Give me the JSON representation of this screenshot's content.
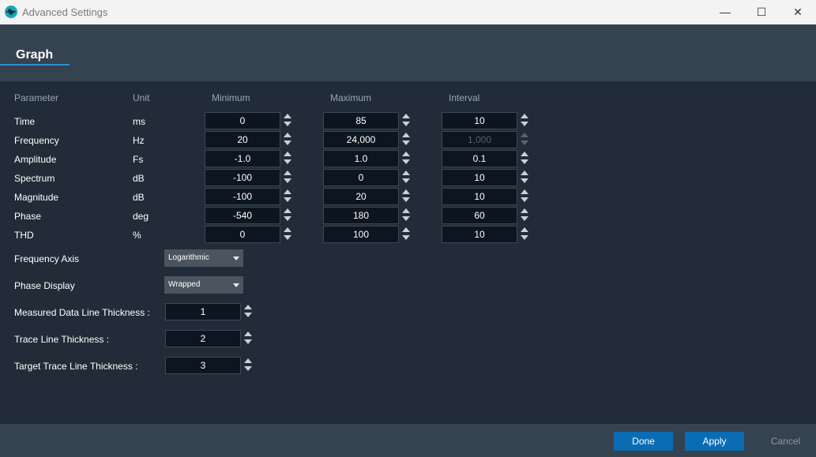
{
  "window": {
    "title": "Advanced Settings",
    "minimize_glyph": "—",
    "maximize_glyph": "☐",
    "close_glyph": "✕"
  },
  "tab": {
    "label": "Graph"
  },
  "columns": {
    "parameter": "Parameter",
    "unit": "Unit",
    "minimum": "Minimum",
    "maximum": "Maximum",
    "interval": "Interval"
  },
  "rows": [
    {
      "name": "Time",
      "unit": "ms",
      "min": "0",
      "max": "85",
      "interval": "10",
      "interval_disabled": false
    },
    {
      "name": "Frequency",
      "unit": "Hz",
      "min": "20",
      "max": "24,000",
      "interval": "1,000",
      "interval_disabled": true
    },
    {
      "name": "Amplitude",
      "unit": "Fs",
      "min": "-1.0",
      "max": "1.0",
      "interval": "0.1",
      "interval_disabled": false
    },
    {
      "name": "Spectrum",
      "unit": "dB",
      "min": "-100",
      "max": "0",
      "interval": "10",
      "interval_disabled": false
    },
    {
      "name": "Magnitude",
      "unit": "dB",
      "min": "-100",
      "max": "20",
      "interval": "10",
      "interval_disabled": false
    },
    {
      "name": "Phase",
      "unit": "deg",
      "min": "-540",
      "max": "180",
      "interval": "60",
      "interval_disabled": false
    },
    {
      "name": "THD",
      "unit": "%",
      "min": "0",
      "max": "100",
      "interval": "10",
      "interval_disabled": false
    }
  ],
  "frequency_axis": {
    "label": "Frequency Axis",
    "value": "Logarithmic"
  },
  "phase_display": {
    "label": "Phase Display",
    "value": "Wrapped"
  },
  "thickness": [
    {
      "label": "Measured Data Line Thickness :",
      "value": "1"
    },
    {
      "label": "Trace Line Thickness :",
      "value": "2"
    },
    {
      "label": "Target Trace Line Thickness :",
      "value": "3"
    }
  ],
  "buttons": {
    "done": "Done",
    "apply": "Apply",
    "cancel": "Cancel"
  },
  "colors": {
    "accent": "#0a6db3",
    "background": "#212c38",
    "header": "#35424f"
  }
}
